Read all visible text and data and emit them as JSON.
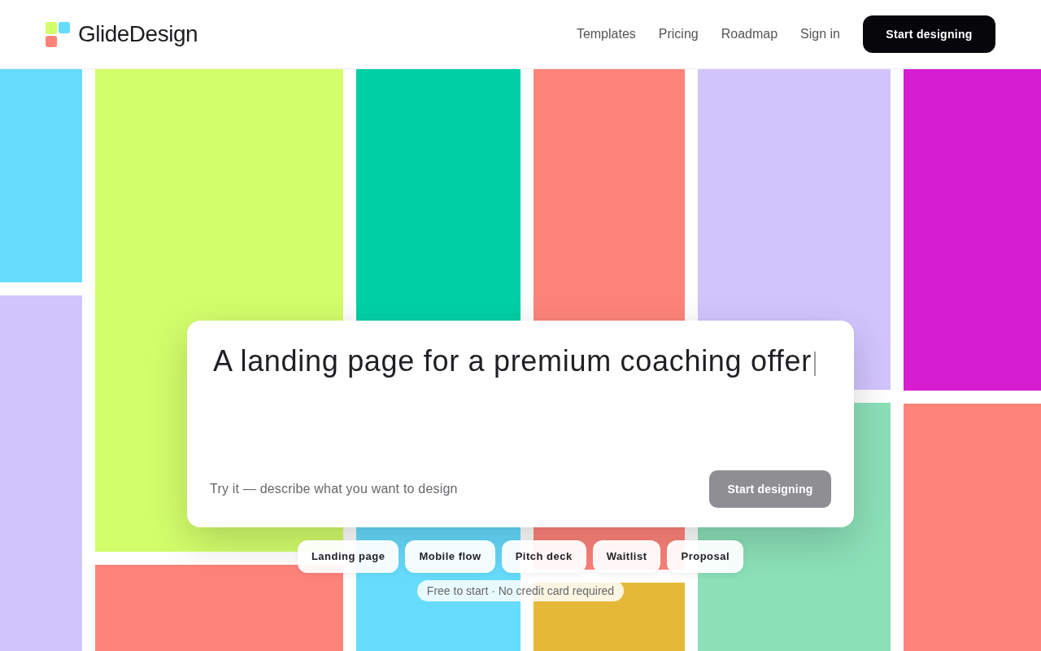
{
  "header": {
    "logo_text": "GlideDesign",
    "nav": [
      {
        "label": "Templates"
      },
      {
        "label": "Pricing"
      },
      {
        "label": "Roadmap"
      },
      {
        "label": "Sign in"
      }
    ],
    "cta": {
      "label": "Start designing"
    }
  },
  "backdrop": {
    "columns": [
      {
        "tiles": [
          {
            "color": "#66dcfd"
          },
          {
            "color": "#d2c4fd"
          }
        ]
      },
      {
        "tiles": [
          {
            "color": "#d3fe6b"
          },
          {
            "color": "#fe847a"
          }
        ]
      },
      {
        "tiles": [
          {
            "color": "#00d0a5"
          },
          {
            "color": "#66dcfd"
          }
        ]
      },
      {
        "tiles": [
          {
            "color": "#fe847a"
          },
          {
            "color": "#e5b937"
          }
        ]
      },
      {
        "tiles": [
          {
            "color": "#d2c4fd"
          },
          {
            "color": "#8be0b8"
          }
        ]
      },
      {
        "tiles": [
          {
            "color": "#d61dcf"
          },
          {
            "color": "#fe847a"
          }
        ]
      }
    ]
  },
  "prompt_card": {
    "value": "A landing page for a premium coaching offer",
    "focused": true,
    "hint": "Try it — describe what you want to design",
    "submit": {
      "label": "Start designing",
      "disabled": true
    }
  },
  "suggestions": [
    {
      "label": "Landing page"
    },
    {
      "label": "Mobile flow"
    },
    {
      "label": "Pitch deck"
    },
    {
      "label": "Waitlist"
    },
    {
      "label": "Proposal"
    }
  ],
  "note": "Free to start · No credit card required"
}
